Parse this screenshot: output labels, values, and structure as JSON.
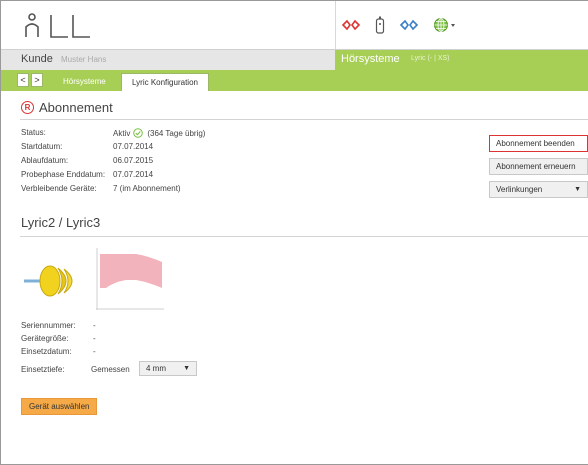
{
  "header": {
    "icons": [
      "logo-icon",
      "hearing-aid-pair-icon",
      "remote-control-icon",
      "wireless-link-icon",
      "globe-icon"
    ]
  },
  "customer_bar": {
    "label": "Kunde",
    "name": "Muster Hans",
    "systems_label": "Hörsysteme",
    "systems_sub": "Lyric (- | XS)"
  },
  "tabs": {
    "prev": "<",
    "next": ">",
    "items": [
      {
        "label": "Hörsysteme",
        "active": false
      },
      {
        "label": "Lyric Konfiguration",
        "active": true
      }
    ]
  },
  "subscription": {
    "title": "Abonnement",
    "badge": "R",
    "rows": [
      {
        "key": "Status:",
        "value": "Aktiv",
        "extra": "(364 Tage übrig)"
      },
      {
        "key": "Startdatum:",
        "value": "07.07.2014"
      },
      {
        "key": "Ablaufdatum:",
        "value": "06.07.2015"
      },
      {
        "key": "Probephase Enddatum:",
        "value": "07.07.2014"
      },
      {
        "key": "Verbleibende Geräte:",
        "value": "7 (im Abonnement)"
      }
    ],
    "buttons": {
      "end": "Abonnement beenden",
      "renew": "Abonnement erneuern",
      "links": "Verlinkungen"
    }
  },
  "lyric": {
    "title": "Lyric2 / Lyric3",
    "rows": [
      {
        "key": "Seriennummer:",
        "value": "-"
      },
      {
        "key": "Gerätegröße:",
        "value": "-"
      },
      {
        "key": "Einsetzdatum:",
        "value": "-"
      }
    ],
    "depth_label": "Einsetztiefe:",
    "depth_mode": "Gemessen",
    "depth_value": "4 mm",
    "select_button": "Gerät auswählen"
  },
  "colors": {
    "green": "#a8cf55",
    "red": "#d33333",
    "orange": "#f5a947",
    "pink": "#f2b3bd",
    "yellow": "#f0d21f"
  }
}
